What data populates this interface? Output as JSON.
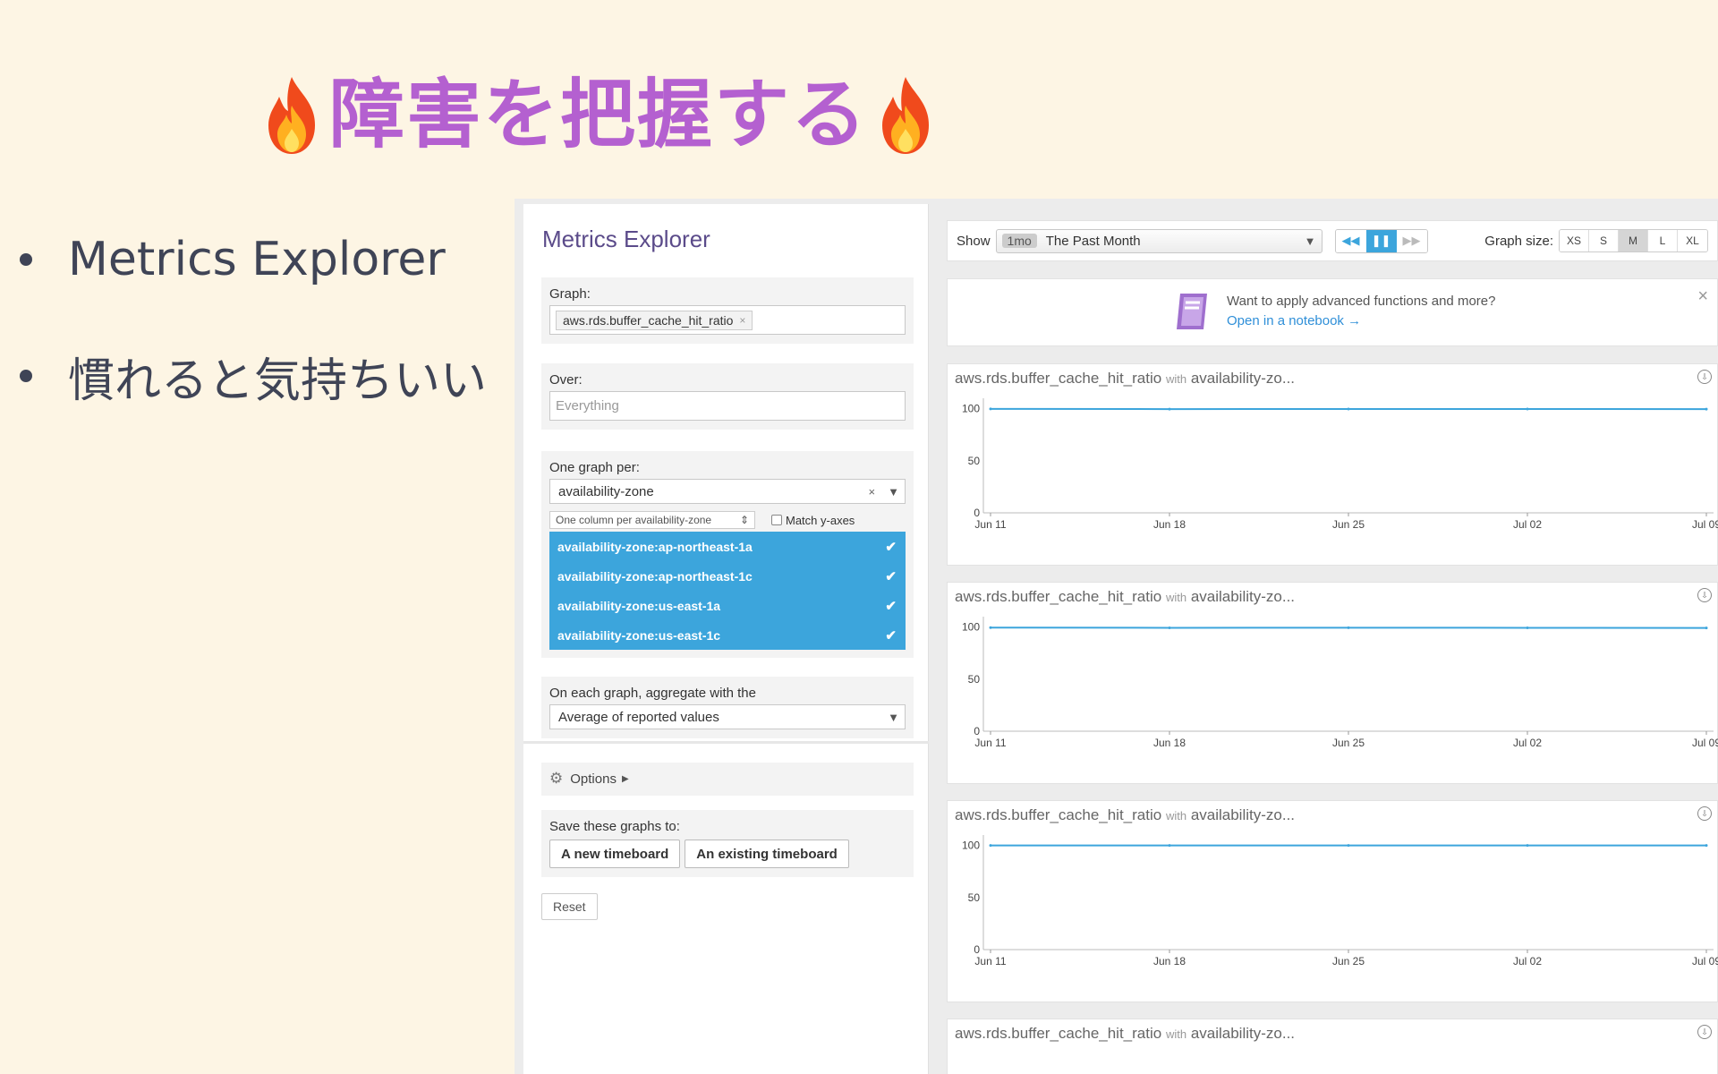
{
  "slide": {
    "title": "障害を把握する",
    "bullets": [
      "Metrics Explorer",
      "慣れると気持ちいい"
    ]
  },
  "explorer": {
    "title": "Metrics Explorer",
    "graph_label": "Graph:",
    "graph_tag": "aws.rds.buffer_cache_hit_ratio",
    "graph_tag_remove": "×",
    "over_label": "Over:",
    "over_placeholder": "Everything",
    "per_label": "One graph per:",
    "per_value": "availability-zone",
    "per_clear": "×",
    "column_select": "One column per availability-zone",
    "match_yaxes": "Match y-axes",
    "zones": [
      "availability-zone:ap-northeast-1a",
      "availability-zone:ap-northeast-1c",
      "availability-zone:us-east-1a",
      "availability-zone:us-east-1c"
    ],
    "aggregate_label": "On each graph, aggregate with the",
    "aggregate_value": "Average of reported values",
    "options_label": "Options",
    "save_label": "Save these graphs to:",
    "new_timeboard": "A new timeboard",
    "existing_timeboard": "An existing timeboard",
    "reset": "Reset"
  },
  "toolbar": {
    "show_label": "Show",
    "range_tag": "1mo",
    "range_value": "The Past Month",
    "graph_size_label": "Graph size:",
    "sizes": [
      "XS",
      "S",
      "M",
      "L",
      "XL"
    ],
    "active_size": "M"
  },
  "banner": {
    "text": "Want to apply advanced functions and more?",
    "link": "Open in a notebook →",
    "close": "×"
  },
  "graphs": {
    "title_metric": "aws.rds.buffer_cache_hit_ratio",
    "title_with": "with",
    "title_group": "availability-zo...",
    "download_icon": "⇩"
  },
  "colors": {
    "accent": "#3ca5dc",
    "title_purple": "#b460d0",
    "slide_bg": "#fdf5e4"
  },
  "chart_data": [
    {
      "type": "line",
      "x": [
        "Jun 11",
        "Jun 18",
        "Jun 25",
        "Jul 02",
        "Jul 09"
      ],
      "x_tick_labels": [
        "Jun 11",
        "Jun 18",
        "Jun 25",
        "Jul 02",
        "Jul 09"
      ],
      "series": [
        {
          "values": [
            99.8,
            99.6,
            99.7,
            99.7,
            99.6
          ]
        }
      ],
      "y_ticks": [
        0,
        50,
        100
      ],
      "ylim": [
        0,
        110
      ]
    },
    {
      "type": "line",
      "x": [
        "Jun 11",
        "Jun 18",
        "Jun 25",
        "Jul 02",
        "Jul 09"
      ],
      "x_tick_labels": [
        "Jun 11",
        "Jun 18",
        "Jun 25",
        "Jul 02",
        "Jul 09"
      ],
      "series": [
        {
          "values": [
            99.5,
            99.3,
            99.4,
            99.3,
            99.2
          ]
        }
      ],
      "y_ticks": [
        0,
        50,
        100
      ],
      "ylim": [
        0,
        110
      ]
    },
    {
      "type": "line",
      "x": [
        "Jun 11",
        "Jun 18",
        "Jun 25",
        "Jul 02",
        "Jul 09"
      ],
      "x_tick_labels": [
        "Jun 11",
        "Jun 18",
        "Jun 25",
        "Jul 02",
        "Jul 09"
      ],
      "series": [
        {
          "values": [
            100,
            100,
            100,
            100,
            100
          ]
        }
      ],
      "y_ticks": [
        0,
        50,
        100
      ],
      "ylim": [
        0,
        110
      ]
    }
  ]
}
